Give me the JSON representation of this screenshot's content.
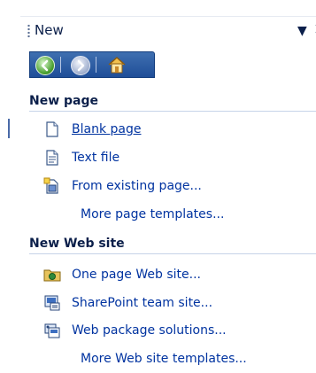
{
  "pane": {
    "title": "New",
    "dropdown_glyph": "▼",
    "close_glyph": "×"
  },
  "nav": {
    "back_icon": "back-arrow-icon",
    "forward_icon": "forward-arrow-icon",
    "home_icon": "home-icon"
  },
  "sections": {
    "new_page": {
      "heading": "New page",
      "items": [
        {
          "label": "Blank page",
          "icon": "blank-page-icon"
        },
        {
          "label": "Text file",
          "icon": "text-file-icon"
        },
        {
          "label": "From existing page...",
          "icon": "existing-page-icon"
        }
      ],
      "more": "More page templates..."
    },
    "new_web_site": {
      "heading": "New Web site",
      "items": [
        {
          "label": "One page Web site...",
          "icon": "folder-web-icon"
        },
        {
          "label": "SharePoint team site...",
          "icon": "sharepoint-icon"
        },
        {
          "label": "Web package solutions...",
          "icon": "web-package-icon"
        }
      ],
      "more": "More Web site templates..."
    }
  },
  "colors": {
    "link": "#0033a0",
    "heading": "#0b1f4a",
    "nav_bg": "#1f4e98"
  }
}
